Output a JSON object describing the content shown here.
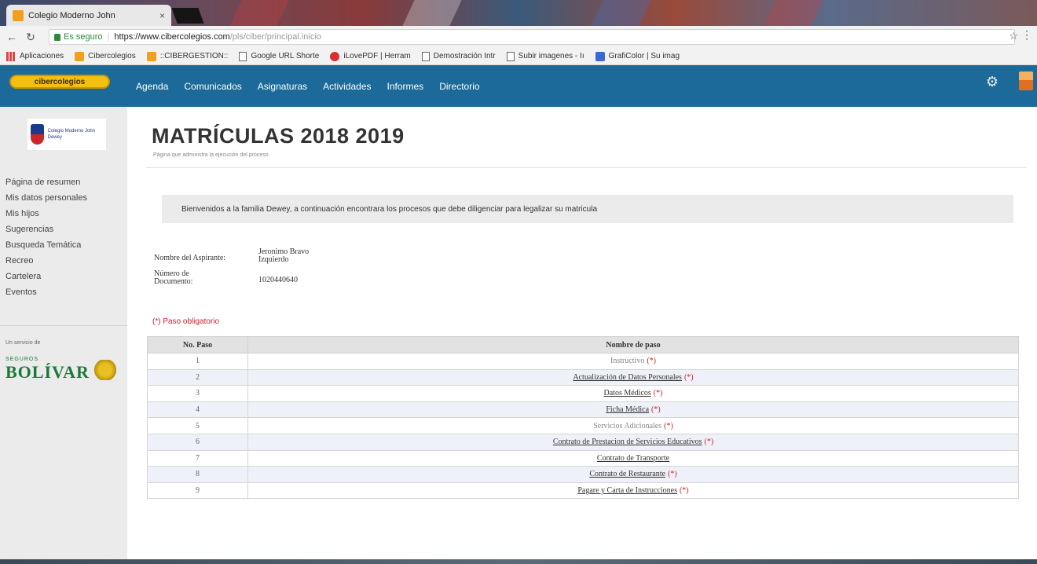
{
  "browser": {
    "tab_title": "Colegio Moderno John",
    "tab_close": "×",
    "secure_label": "Es seguro",
    "url_host": "https://www.cibercolegios.com",
    "url_path": "/pls/ciber/principal.inicio",
    "bookmarks": [
      {
        "label": "Aplicaciones",
        "icon": "apps-grid-icon"
      },
      {
        "label": "Cibercolegios",
        "icon": "cibercolegios-icon"
      },
      {
        "label": "::CIBERGESTION::",
        "icon": "cibergestion-icon"
      },
      {
        "label": "Google URL Shorte",
        "icon": "document-icon"
      },
      {
        "label": "iLovePDF | Herram",
        "icon": "ilovepdf-icon"
      },
      {
        "label": "Demostración Intr",
        "icon": "document-icon"
      },
      {
        "label": "Subir imagenes - Iı",
        "icon": "document-icon"
      },
      {
        "label": "GrafiColor | Su imag",
        "icon": "graficolor-icon"
      }
    ]
  },
  "appnav": {
    "brand": "cibercolegios",
    "links": [
      "Agenda",
      "Comunicados",
      "Asignaturas",
      "Actividades",
      "Informes",
      "Directorio"
    ]
  },
  "sidebar": {
    "school_name": "Colegio Moderno John Dewey",
    "menu": [
      "Página de resumen",
      "Mis datos personales",
      "Mis hijos",
      "Sugerencias",
      "Busqueda Temática",
      "Recreo",
      "Cartelera",
      "Eventos"
    ],
    "sponsor_label": "Un servicio de",
    "sponsor_small": "SEGUROS",
    "sponsor_big": "BOLÍVAR"
  },
  "main": {
    "title": "MATRÍCULAS 2018 2019",
    "subtitle": "Página que administra la ejecución del proceso",
    "welcome": "Bienvenidos a la familia Dewey, a continuación encontrara los procesos que debe diligenciar para legalizar su matricula",
    "applicant_label": "Nombre del Aspirante:",
    "applicant_value": "Jeronimo Bravo Izquierdo",
    "document_label": "Número de Documento:",
    "document_value": "1020440640",
    "required_note": "(*) Paso obligatorio"
  },
  "table": {
    "headers": [
      "No. Paso",
      "Nombre de paso"
    ],
    "rows": [
      {
        "no": "1",
        "name": "Instructivo",
        "linked": false,
        "required": true
      },
      {
        "no": "2",
        "name": "Actualización de Datos Personales",
        "linked": true,
        "required": true
      },
      {
        "no": "3",
        "name": "Datos Médicos",
        "linked": true,
        "required": true
      },
      {
        "no": "4",
        "name": "Ficha Médica",
        "linked": true,
        "required": true
      },
      {
        "no": "5",
        "name": "Servicios Adicionales",
        "linked": false,
        "required": true
      },
      {
        "no": "6",
        "name": "Contrato de Prestacion de Servicios Educativos",
        "linked": true,
        "required": true
      },
      {
        "no": "7",
        "name": "Contrato de Transporte",
        "linked": true,
        "required": false
      },
      {
        "no": "8",
        "name": "Contrato de Restaurante",
        "linked": true,
        "required": true
      },
      {
        "no": "9",
        "name": "Pagare y Carta de Instrucciones",
        "linked": true,
        "required": true
      }
    ],
    "required_mark": "(*)"
  }
}
